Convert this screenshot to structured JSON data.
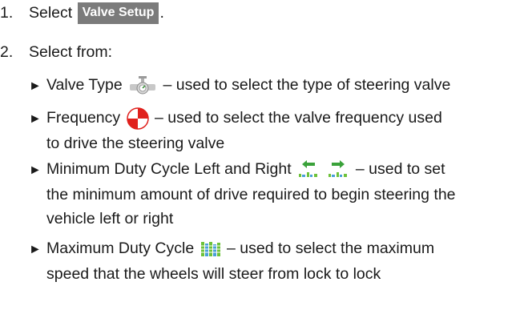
{
  "steps": [
    {
      "number": "1.",
      "text_before": "Select",
      "button_label": "Valve Setup",
      "text_after": "."
    },
    {
      "number": "2.",
      "text": "Select from:"
    }
  ],
  "options": [
    {
      "name": "Valve Type",
      "icon": "valve-icon",
      "desc": " – used to select the type of steering valve"
    },
    {
      "name": "Frequency",
      "icon": "frequency-icon",
      "desc_line1": " – used to select the valve frequency used",
      "desc_line2": "to drive the steering valve"
    },
    {
      "name": "Minimum Duty Cycle Left and Right",
      "icons": [
        "duty-cycle-left-icon",
        "duty-cycle-right-icon"
      ],
      "desc_line1": " – used to set",
      "desc_line2": "the minimum amount of drive required to begin steering the",
      "desc_line3": "vehicle left or right"
    },
    {
      "name": "Maximum Duty Cycle",
      "icon": "max-duty-cycle-icon",
      "desc_line1": " – used to select the maximum",
      "desc_line2": "speed that the wheels will steer from lock to lock"
    }
  ],
  "colors": {
    "button_bg": "#7b7b7b",
    "arrow_green": "#3aa23a",
    "bar_green": "#6ec23a",
    "bar_blue": "#4aa0d8",
    "frequency_red": "#e0201c"
  }
}
